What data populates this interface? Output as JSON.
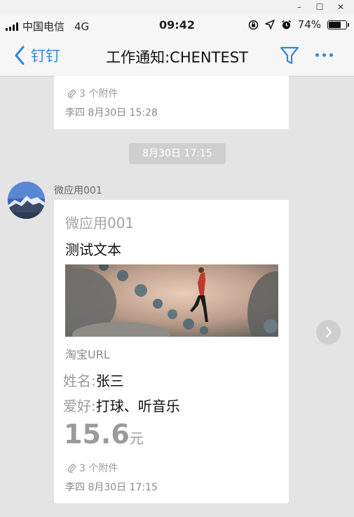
{
  "window": {
    "minimize": "–",
    "maximize": "☐",
    "close": "✕"
  },
  "status_bar": {
    "carrier": "中国电信",
    "network": "4G",
    "time": "09:42",
    "battery": "74%",
    "battery_level": 0.74
  },
  "nav": {
    "back_label": "钉钉",
    "title": "工作通知:CHENTEST"
  },
  "prev_message": {
    "attachments": "3 个附件",
    "meta": "李四  8月30日 15:28"
  },
  "time_divider": "8月30日 17:15",
  "message": {
    "sender": "微应用001",
    "app_name": "微应用001",
    "title": "测试文本",
    "url_label": "淘宝URL",
    "name_key": "姓名:",
    "name_value": "张三",
    "hobby_key": "爱好:",
    "hobby_value": "打球、听音乐",
    "price": "15.6",
    "price_unit": "元",
    "attachments": "3 个附件",
    "meta": "李四  8月30日 17:15"
  },
  "colors": {
    "accent": "#2f86e0",
    "background": "#e4e4e4"
  }
}
